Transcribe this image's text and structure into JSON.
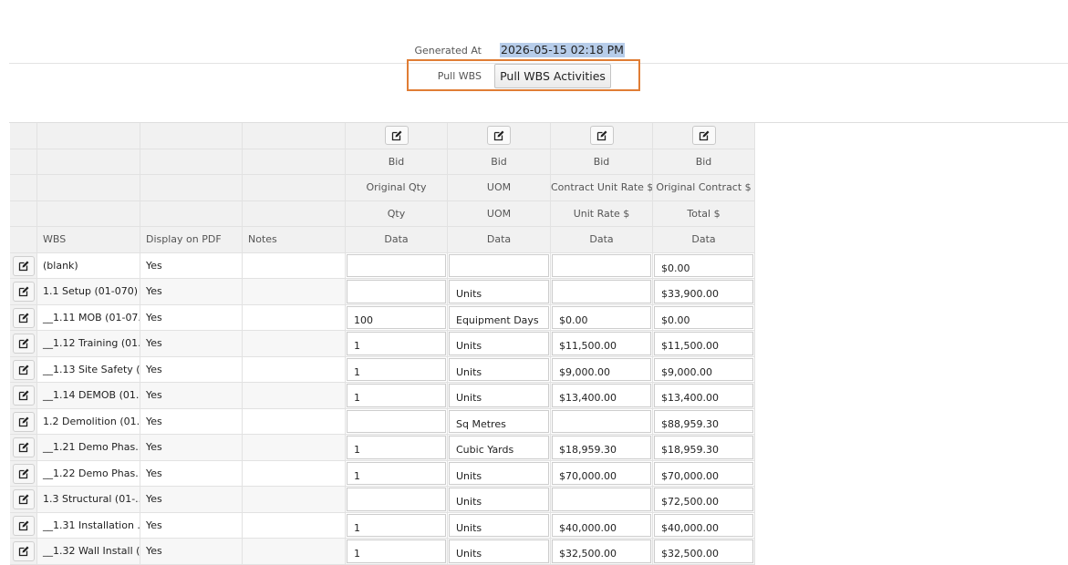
{
  "header": {
    "generated_label": "Generated At",
    "generated_value": "2026-05-15 02:18 PM",
    "pull_label": "Pull WBS",
    "pull_button": "Pull WBS Activities"
  },
  "icons": {
    "edit": "edit-icon"
  },
  "colors": {
    "highlight_border": "#e07d35",
    "selection": "#b7cdea"
  },
  "table": {
    "header_rows": [
      [
        "",
        "",
        "",
        "",
        "Bid",
        "Bid",
        "Bid",
        "Bid"
      ],
      [
        "",
        "",
        "",
        "",
        "Original Qty",
        "UOM",
        "Contract Unit Rate $",
        "Original Contract $"
      ],
      [
        "",
        "",
        "",
        "",
        "Qty",
        "UOM",
        "Unit Rate $",
        "Total $"
      ],
      [
        "",
        "WBS",
        "Display on PDF",
        "Notes",
        "Data",
        "Data",
        "Data",
        "Data"
      ]
    ],
    "rows": [
      {
        "wbs": "(blank)",
        "display": "Yes",
        "notes": "",
        "qty": "",
        "uom": "",
        "rate": "",
        "total": "$0.00"
      },
      {
        "wbs": "1.1 Setup (01-070)",
        "display": "Yes",
        "notes": "",
        "qty": "",
        "uom": "Units",
        "rate": "",
        "total": "$33,900.00"
      },
      {
        "wbs": "__1.11 MOB (01-07...",
        "display": "Yes",
        "notes": "",
        "qty": "100",
        "uom": "Equipment Days",
        "rate": "$0.00",
        "total": "$0.00"
      },
      {
        "wbs": "__1.12 Training (01...",
        "display": "Yes",
        "notes": "",
        "qty": "1",
        "uom": "Units",
        "rate": "$11,500.00",
        "total": "$11,500.00"
      },
      {
        "wbs": "__1.13 Site Safety (...",
        "display": "Yes",
        "notes": "",
        "qty": "1",
        "uom": "Units",
        "rate": "$9,000.00",
        "total": "$9,000.00"
      },
      {
        "wbs": "__1.14 DEMOB (01...",
        "display": "Yes",
        "notes": "",
        "qty": "1",
        "uom": "Units",
        "rate": "$13,400.00",
        "total": "$13,400.00"
      },
      {
        "wbs": "1.2 Demolition (01...",
        "display": "Yes",
        "notes": "",
        "qty": "",
        "uom": "Sq Metres",
        "rate": "",
        "total": "$88,959.30"
      },
      {
        "wbs": "__1.21 Demo Phas...",
        "display": "Yes",
        "notes": "",
        "qty": "1",
        "uom": "Cubic Yards",
        "rate": "$18,959.30",
        "total": "$18,959.30"
      },
      {
        "wbs": "__1.22 Demo Phas...",
        "display": "Yes",
        "notes": "",
        "qty": "1",
        "uom": "Units",
        "rate": "$70,000.00",
        "total": "$70,000.00"
      },
      {
        "wbs": "1.3 Structural (01-...",
        "display": "Yes",
        "notes": "",
        "qty": "",
        "uom": "Units",
        "rate": "",
        "total": "$72,500.00"
      },
      {
        "wbs": "__1.31 Installation ...",
        "display": "Yes",
        "notes": "",
        "qty": "1",
        "uom": "Units",
        "rate": "$40,000.00",
        "total": "$40,000.00"
      },
      {
        "wbs": "__1.32 Wall Install (...",
        "display": "Yes",
        "notes": "",
        "qty": "1",
        "uom": "Units",
        "rate": "$32,500.00",
        "total": "$32,500.00"
      }
    ]
  }
}
